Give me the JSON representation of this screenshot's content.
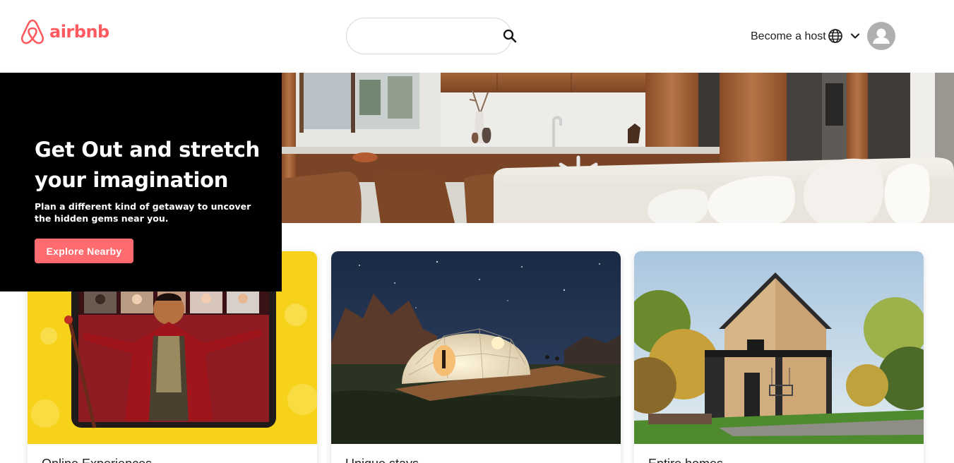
{
  "brand": {
    "name": "airbnb",
    "color": "#ff5a5f"
  },
  "search": {
    "placeholder": "",
    "value": "",
    "icon": "search-icon"
  },
  "nav": {
    "host_label": "Become a host",
    "language_icon": "globe-icon",
    "menu_icon": "chevron-down-icon",
    "avatar_icon": "user-icon"
  },
  "hero": {
    "title": "Get Out and stretch your imagination",
    "subtitle": "Plan a different kind of getaway to uncover the hidden gems near you.",
    "button_label": "Explore Nearby",
    "button_color": "#ff6b6f"
  },
  "cards": [
    {
      "title": "Online Experiences"
    },
    {
      "title": "Unique stays"
    },
    {
      "title": "Entire homes"
    }
  ]
}
